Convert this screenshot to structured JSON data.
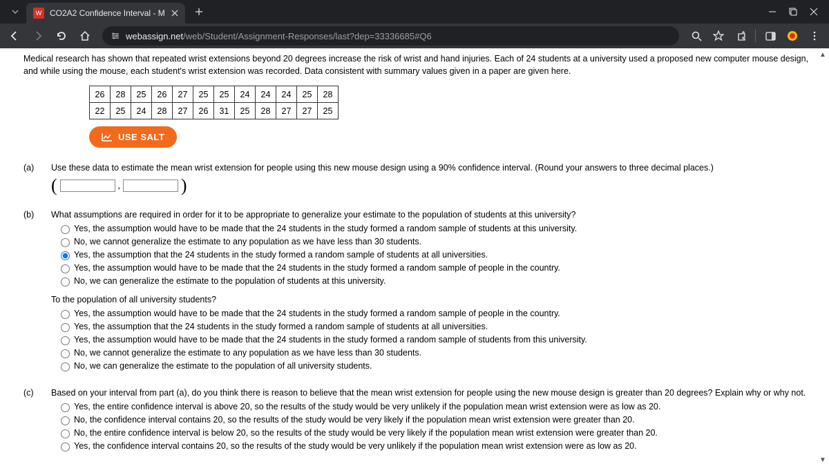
{
  "tab": {
    "title": "CO2A2 Confidence Interval - M"
  },
  "address": {
    "host": "webassign.net",
    "path": "/web/Student/Assignment-Responses/last?dep=33336685#Q6"
  },
  "intro": "Medical research has shown that repeated wrist extensions beyond 20 degrees increase the risk of wrist and hand injuries. Each of 24 students at a university used a proposed new computer mouse design, and while using the mouse, each student's wrist extension was recorded. Data consistent with summary values given in a paper are given here.",
  "data_rows": [
    [
      "26",
      "28",
      "25",
      "26",
      "27",
      "25",
      "25",
      "24",
      "24",
      "24",
      "25",
      "28"
    ],
    [
      "22",
      "25",
      "24",
      "28",
      "27",
      "26",
      "31",
      "25",
      "28",
      "27",
      "27",
      "25"
    ]
  ],
  "salt_label": "USE SALT",
  "qa": {
    "label": "(a)",
    "text": "Use these data to estimate the mean wrist extension for people using this new mouse design using a 90% confidence interval. (Round your answers to three decimal places.)",
    "lower": "",
    "upper": ""
  },
  "qb": {
    "label": "(b)",
    "text": "What assumptions are required in order for it to be appropriate to generalize your estimate to the population of students at this university?",
    "opts1": [
      "Yes, the assumption would have to be made that the 24 students in the study formed a random sample of students at this university.",
      "No, we cannot generalize the estimate to any population as we have less than 30 students.",
      "Yes, the assumption that the 24 students in the study formed a random sample of students at all universities.",
      "Yes, the assumption would have to be made that the 24 students in the study formed a random sample of people in the country.",
      "No, we can generalize the estimate to the population of students at this university."
    ],
    "selected1": 2,
    "sub": "To the population of all university students?",
    "opts2": [
      "Yes, the assumption would have to be made that the 24 students in the study formed a random sample of people in the country.",
      "Yes, the assumption that the 24 students in the study formed a random sample of students at all universities.",
      "Yes, the assumption would have to be made that the 24 students in the study formed a random sample of students from this university.",
      "No, we cannot generalize the estimate to any population as we have less than 30 students.",
      "No, we can generalize the estimate to the population of all university students."
    ]
  },
  "qc": {
    "label": "(c)",
    "text": "Based on your interval from part (a), do you think there is reason to believe that the mean wrist extension for people using the new mouse design is greater than 20 degrees? Explain why or why not.",
    "opts": [
      "Yes, the entire confidence interval is above 20, so the results of the study would be very unlikely if the population mean wrist extension were as low as 20.",
      "No, the confidence interval contains 20, so the results of the study would be very likely if the population mean wrist extension were greater than 20.",
      "No, the entire confidence interval is below 20, so the results of the study would be very likely if the population mean wrist extension were greater than 20.",
      "Yes, the confidence interval contains 20, so the results of the study would be very unlikely if the population mean wrist extension were as low as 20."
    ]
  }
}
